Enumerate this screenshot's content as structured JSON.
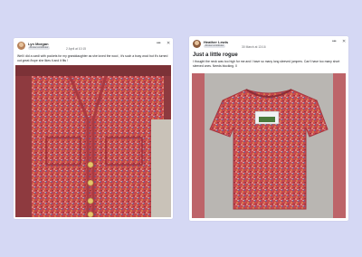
{
  "posts": [
    {
      "author": "Lyn Morgan",
      "badge": "All-star contributor",
      "time": "2 April at 10:15",
      "more": "•••",
      "close": "✕",
      "text": "Well i did a cardi with pockets for my granddaughter as she loved the wool , it's such a busy wool but it's turned out great /hope she likes it and it fits !"
    },
    {
      "author": "Heather Lewis",
      "badge": "All-star contributor",
      "time": "30 March at 13:16",
      "more": "•••",
      "close": "✕",
      "title": "Just a little rogue",
      "text": "I thought the neck was too high for me and I have so many long sleeved jumpers. Can't have too many short sleeved ones. Needs blocking. X"
    }
  ],
  "colors": {
    "background": "#d5d8f4",
    "photo_frame_1": "#8e3a3f",
    "photo_frame_2": "#bd6469",
    "knit_main": "#c84b4e"
  }
}
